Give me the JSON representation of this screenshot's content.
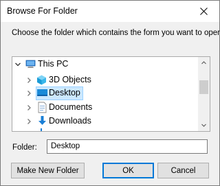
{
  "dialog": {
    "title": "Browse For Folder",
    "instruction": "Choose the folder which contains the form you want to open.",
    "close_icon": "close-icon"
  },
  "tree": {
    "items": [
      {
        "label": "This PC",
        "icon": "computer-icon",
        "expanded": true,
        "selected": false
      },
      {
        "label": "3D Objects",
        "icon": "3d-objects-icon",
        "expanded": false,
        "selected": false
      },
      {
        "label": "Desktop",
        "icon": "desktop-icon",
        "expanded": false,
        "selected": true
      },
      {
        "label": "Documents",
        "icon": "documents-icon",
        "expanded": false,
        "selected": false
      },
      {
        "label": "Downloads",
        "icon": "downloads-icon",
        "expanded": false,
        "selected": false
      }
    ]
  },
  "folder": {
    "label": "Folder:",
    "value": "Desktop"
  },
  "buttons": {
    "make_new_folder": "Make New Folder",
    "ok": "OK",
    "cancel": "Cancel"
  },
  "colors": {
    "selection": "#cce8ff",
    "selection_border": "#99d1ff",
    "accent": "#0078d7"
  }
}
